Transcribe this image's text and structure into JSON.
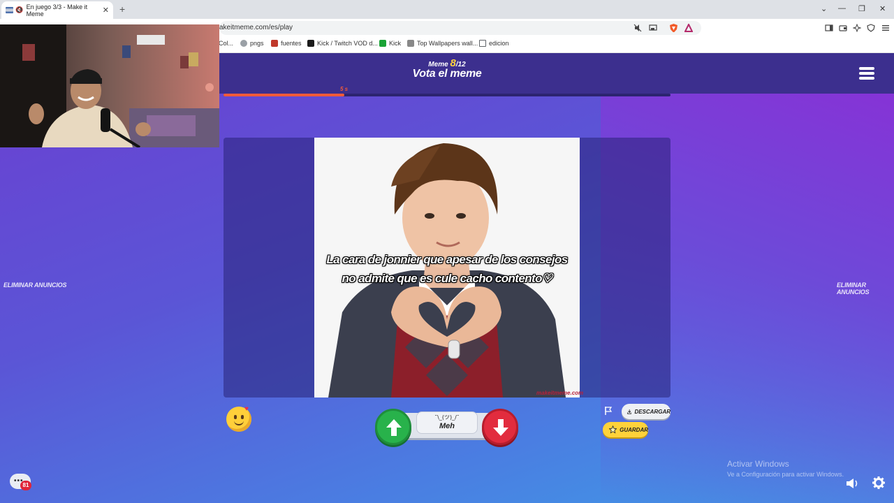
{
  "browser": {
    "tab_title": "En juego 3/3 - Make it Meme",
    "tab_close": "✕",
    "new_tab": "+",
    "window_controls": {
      "minimize": "—",
      "restore": "❐",
      "close": "✕",
      "tab_search": "⌄"
    },
    "url": "akeitmeme.com/es/play",
    "bookmarks": [
      {
        "label": "Col...",
        "icon": "bookmark-icon",
        "color": "#888888"
      },
      {
        "label": "pngs",
        "icon": "pin-icon",
        "color": "#5f6368"
      },
      {
        "label": "fuentes",
        "icon": "font-site-icon",
        "color": "#c0392b"
      },
      {
        "label": "Kick / Twitch VOD d...",
        "icon": "kick-d-icon",
        "color": "#1b1b1b"
      },
      {
        "label": "Kick",
        "icon": "kick-icon",
        "color": "#1aa336"
      },
      {
        "label": "Top Wallpapers wall...",
        "icon": "wallpaper-icon",
        "color": "#777777"
      },
      {
        "label": "edicion",
        "icon": "folder-icon",
        "color": "#5f6368"
      }
    ]
  },
  "game": {
    "meme_label": "Meme",
    "meme_current": "8",
    "meme_total": "/12",
    "title": "Vota el meme",
    "timer_label": "5 s",
    "timer_progress": 0.27,
    "caption_line1": "La cara de jonnier que apesar de los consejos",
    "caption_line2": "no admite que es cule cacho contento♡",
    "watermark": "makeitmeme.com",
    "remove_ads_left": "ELIMINAR ANUNCIOS",
    "remove_ads_right": "ELIMINAR ANUNCIOS",
    "meh_shrug": "¯\\_(ツ)_/¯",
    "meh_label": "Meh",
    "download_label": "DESCARGAR",
    "save_label": "GUARDAR",
    "chat_badge": "81",
    "colors": {
      "upvote": "#28b24b",
      "downvote": "#e22c3e",
      "accent": "#ffd23d",
      "header": "#3c2f8e"
    }
  },
  "windows": {
    "activate_title": "Activar Windows",
    "activate_subtitle": "Ve a Configuración para activar Windows."
  }
}
